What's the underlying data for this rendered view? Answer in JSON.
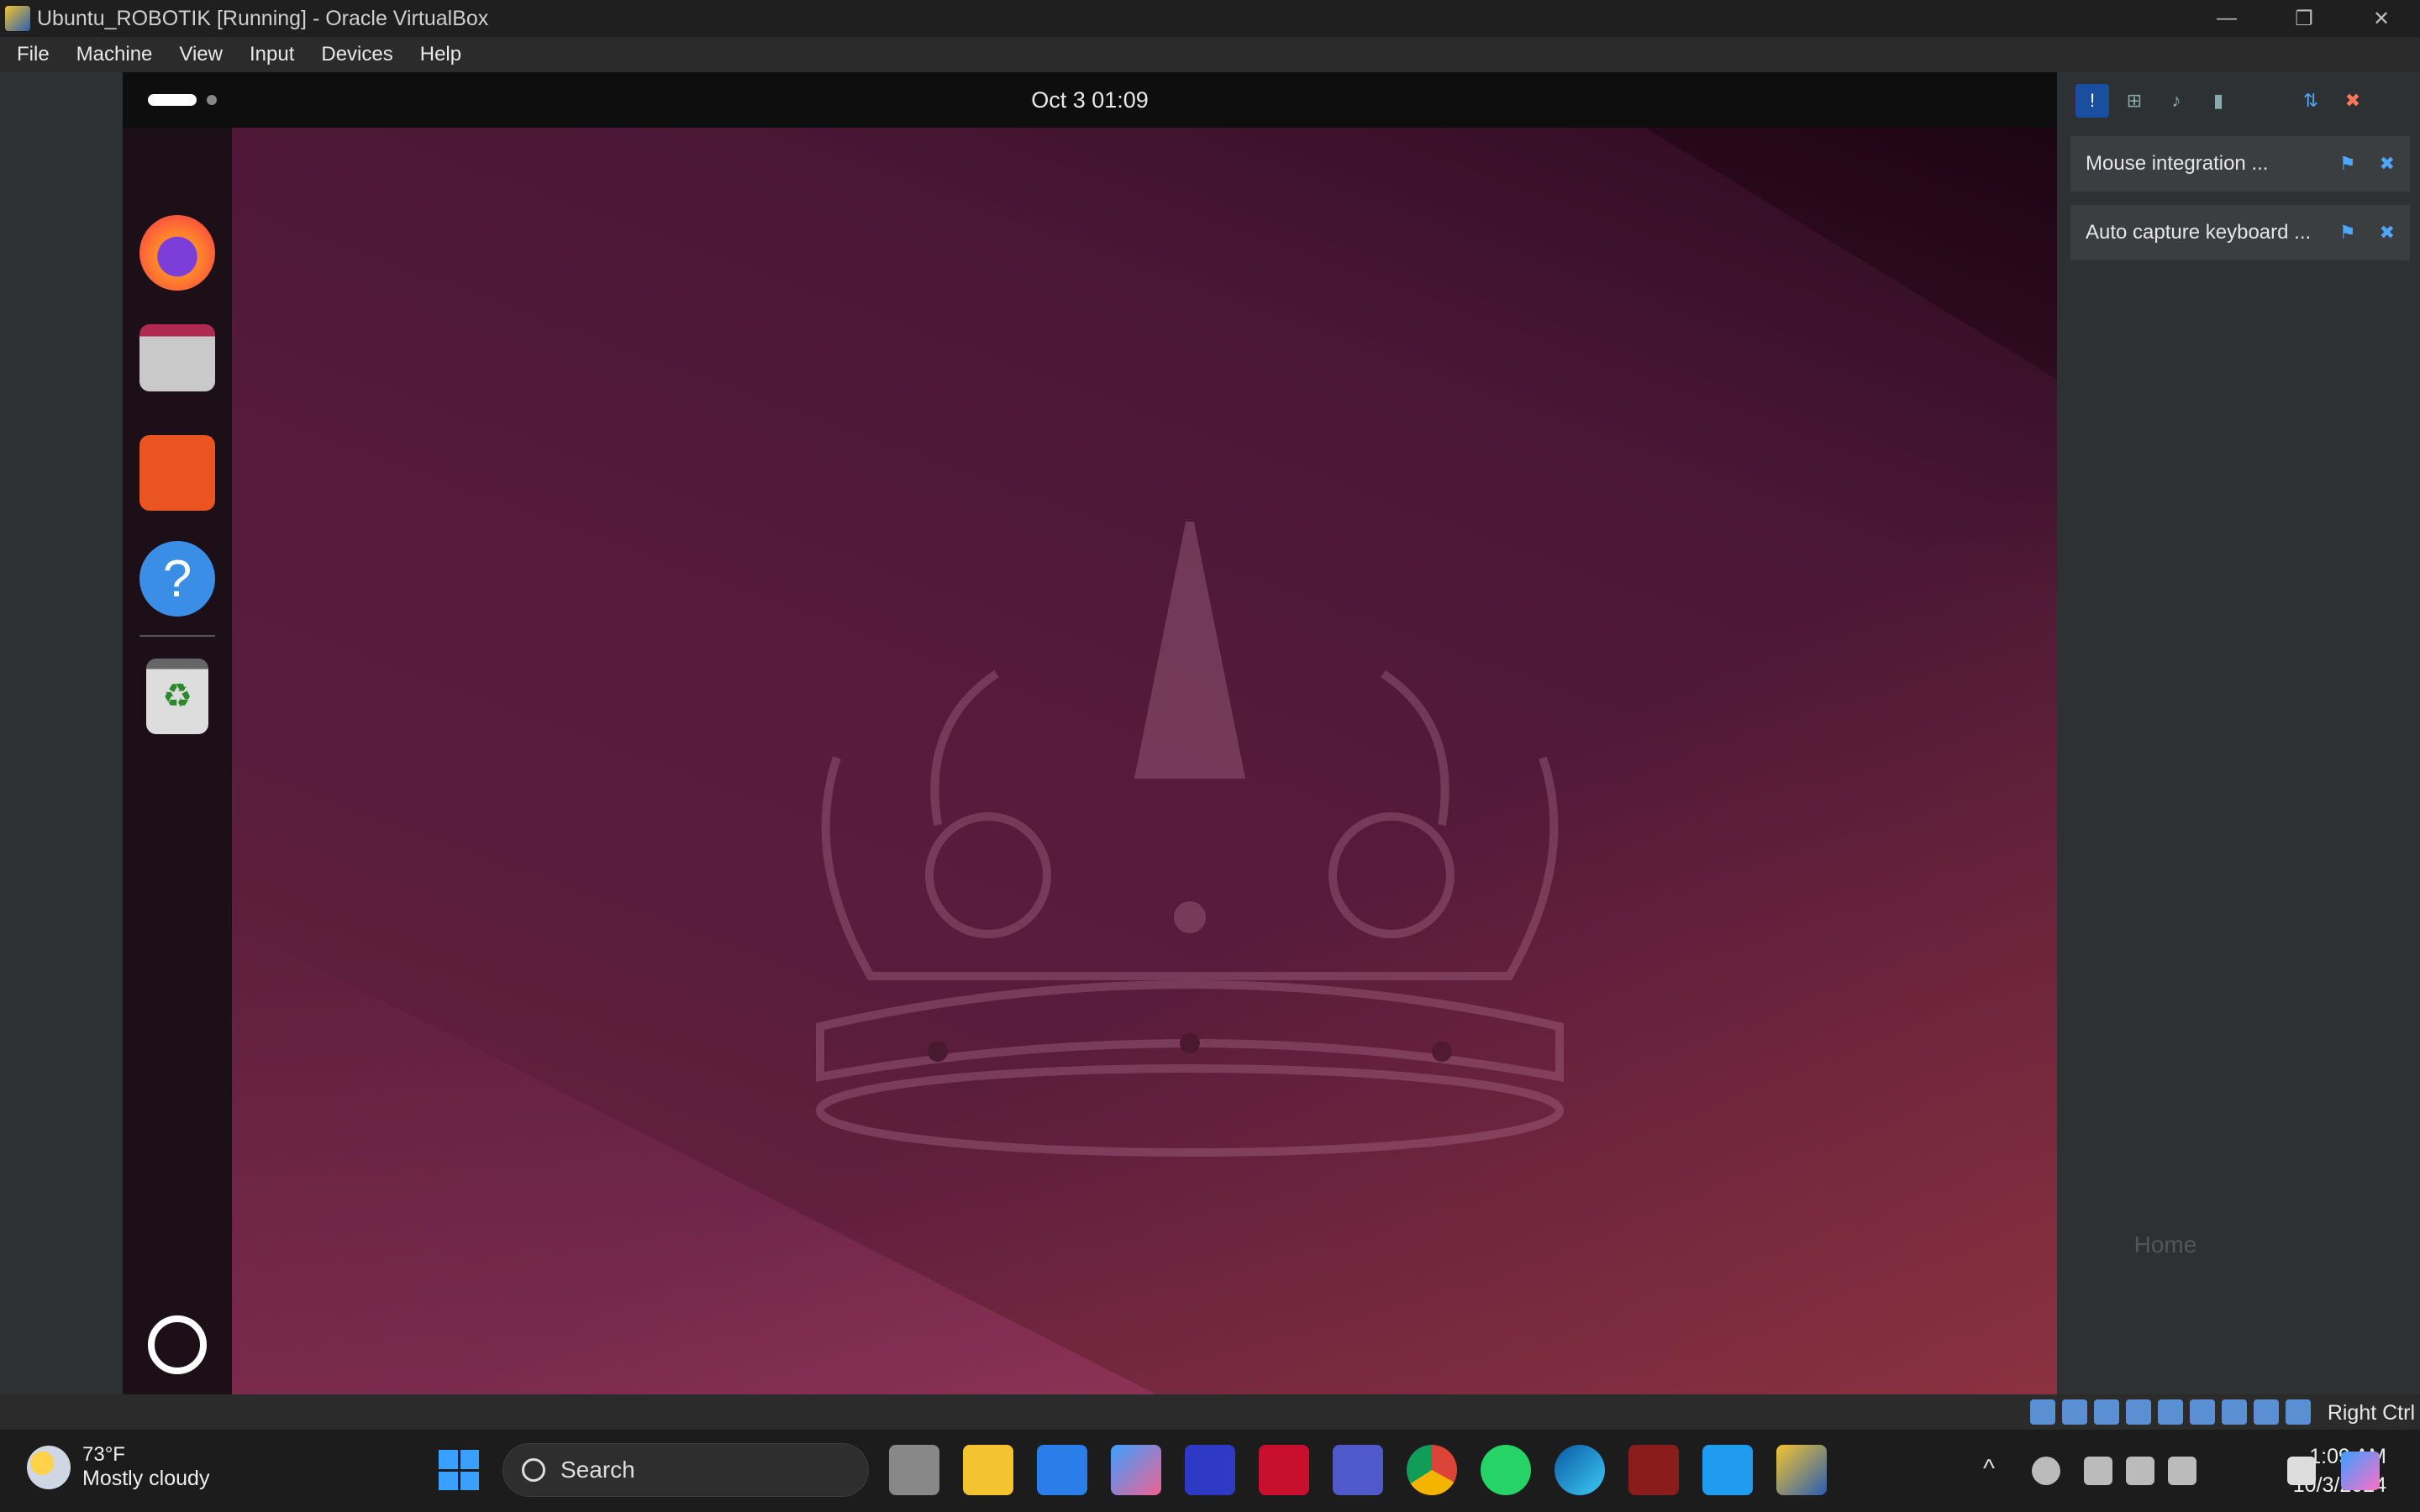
{
  "window": {
    "title": "Ubuntu_ROBOTIK [Running] - Oracle VirtualBox",
    "controls": [
      "minimize-icon",
      "restore-icon",
      "close-icon"
    ]
  },
  "menu": [
    "File",
    "Machine",
    "View",
    "Input",
    "Devices",
    "Help"
  ],
  "ubuntu": {
    "clock": "Oct 3  01:09",
    "dock_items": [
      "firefox-icon",
      "files-icon",
      "app-center-icon",
      "help-icon",
      "trash-icon",
      "show-apps-icon"
    ]
  },
  "notifications": [
    {
      "text": "Mouse integration ..."
    },
    {
      "text": "Auto capture keyboard ..."
    }
  ],
  "ghost": {
    "label": "Home"
  },
  "vbox_status": {
    "host_key": "Right Ctrl"
  },
  "taskbar": {
    "weather_temp": "73°F",
    "weather_desc": "Mostly cloudy",
    "search_label": "Search",
    "time": "1:09 AM",
    "date": "10/3/2024"
  }
}
